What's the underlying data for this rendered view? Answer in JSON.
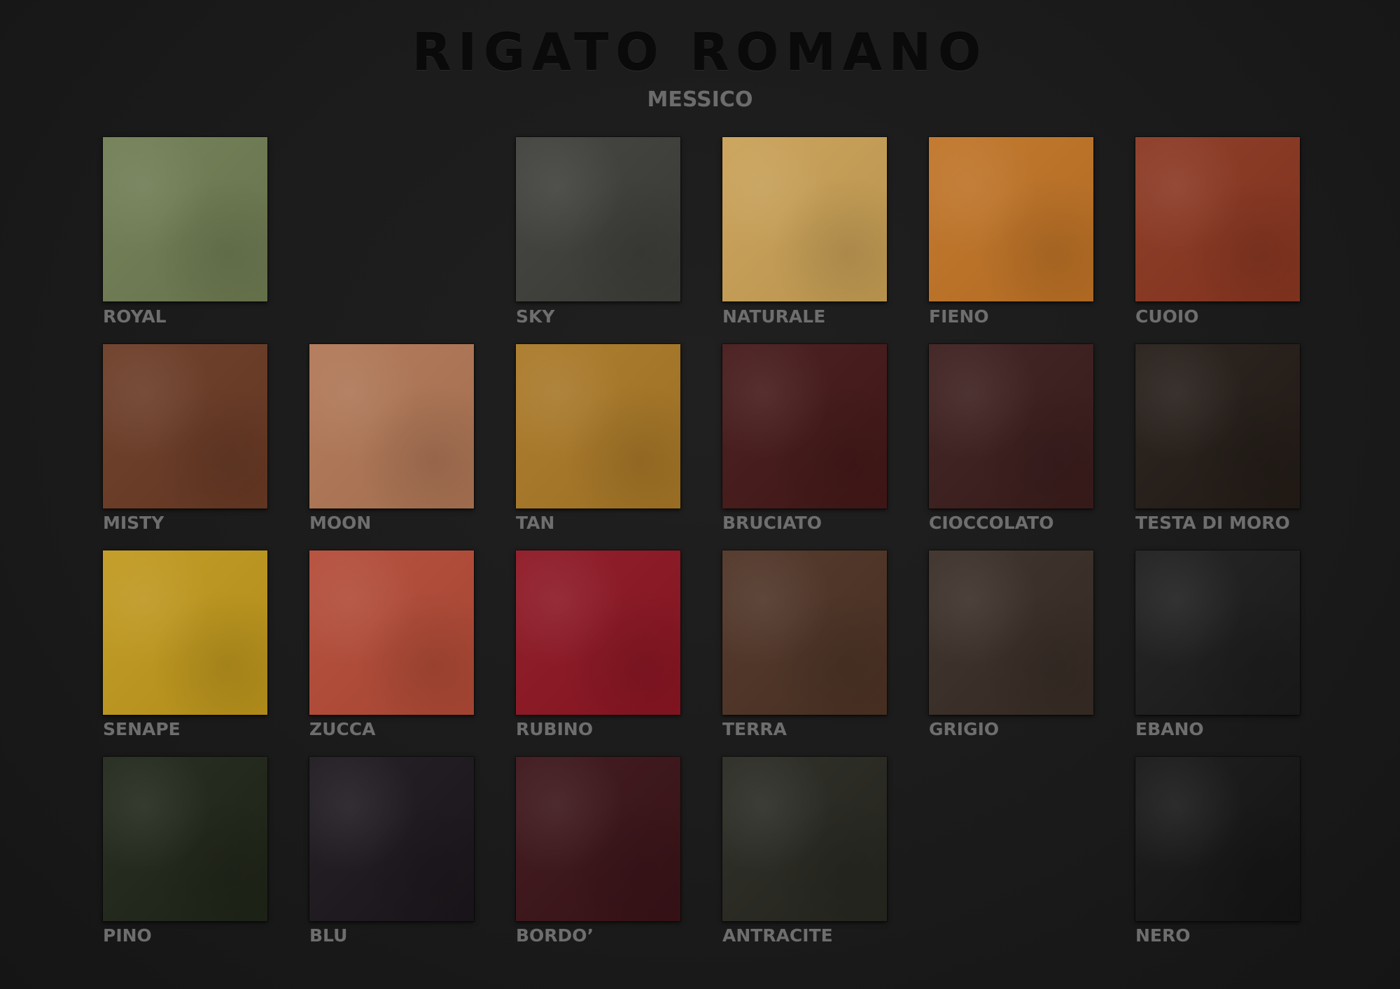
{
  "header": {
    "brand": "RIGATO ROMANO",
    "collection": "MESSICO"
  },
  "swatches": [
    {
      "name": "ROYAL",
      "color": "#6f7c52"
    },
    {
      "name": "SKY",
      "color": "#3d3e39"
    },
    {
      "name": "NATURALE",
      "color": "#c9a055"
    },
    {
      "name": "FIENO",
      "color": "#c07325"
    },
    {
      "name": "CUOIO",
      "color": "#8a3620"
    },
    {
      "name": "MISTY",
      "color": "#6a3a24"
    },
    {
      "name": "MOON",
      "color": "#b07655"
    },
    {
      "name": "TAN",
      "color": "#a97826"
    },
    {
      "name": "BRUCIATO",
      "color": "#441717"
    },
    {
      "name": "CIOCCOLATO",
      "color": "#3b1c1c"
    },
    {
      "name": "TESTA DI MORO",
      "color": "#231b16"
    },
    {
      "name": "SENAPE",
      "color": "#c0981c"
    },
    {
      "name": "ZUCCA",
      "color": "#b34a36"
    },
    {
      "name": "RUBINO",
      "color": "#8c1522"
    },
    {
      "name": "TERRA",
      "color": "#4d3224"
    },
    {
      "name": "GRIGIO",
      "color": "#382c25"
    },
    {
      "name": "EBANO",
      "color": "#1c1b1c"
    },
    {
      "name": "PINO",
      "color": "#1f2518"
    },
    {
      "name": "BLU",
      "color": "#1b161c"
    },
    {
      "name": "BORDO’",
      "color": "#3a1217"
    },
    {
      "name": "ANTRACITE",
      "color": "#272720"
    },
    {
      "name": "NERO",
      "color": "#141414"
    }
  ]
}
